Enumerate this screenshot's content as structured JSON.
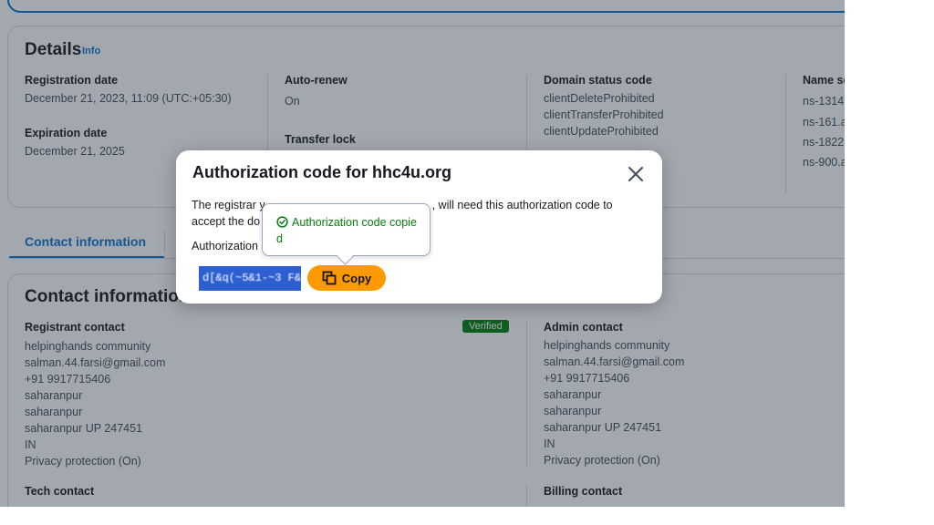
{
  "details": {
    "title": "Details",
    "info_link": "Info",
    "registration_date": {
      "label": "Registration date",
      "value": "December 21, 2023, 11:09 (UTC:+05:30)"
    },
    "expiration_date": {
      "label": "Expiration date",
      "value": "December 21, 2025"
    },
    "auto_renew": {
      "label": "Auto-renew",
      "value": "On"
    },
    "transfer_lock": {
      "label": "Transfer lock"
    },
    "domain_status": {
      "label": "Domain status code",
      "values": [
        "clientDeleteProhibited",
        "clientTransferProhibited",
        "clientUpdateProhibited"
      ]
    },
    "name_servers": {
      "label": "Name se",
      "values": [
        "ns-1314",
        "ns-161.a",
        "ns-1822",
        "ns-900.a"
      ]
    }
  },
  "tabs": {
    "contact_information": "Contact information"
  },
  "contact": {
    "title": "Contact information",
    "registrant": {
      "label": "Registrant contact",
      "badge": "Verified",
      "lines": [
        "helpinghands community",
        "salman.44.farsi@gmail.com",
        "+91 9917715406",
        "saharanpur",
        "saharanpur",
        "saharanpur UP 247451",
        "IN",
        "Privacy protection (On)"
      ]
    },
    "admin": {
      "label": "Admin contact",
      "lines": [
        "helpinghands community",
        "salman.44.farsi@gmail.com",
        "+91 9917715406",
        "saharanpur",
        "saharanpur",
        "saharanpur UP 247451",
        "IN",
        "Privacy protection (On)"
      ]
    },
    "tech": {
      "label": "Tech contact"
    },
    "billing": {
      "label": "Billing contact"
    }
  },
  "modal": {
    "title": "Authorization code for hhc4u.org",
    "description_part1": "The registrar y",
    "description_part2": ", will need this authorization code to",
    "description_line2": "accept the do",
    "code_label": "Authorization",
    "code_value": "d[&q(~5&1-~3 F&\\",
    "copy_label": "Copy",
    "popover_text": "Authorization code copied"
  },
  "colors": {
    "accent": "#0972d3",
    "primary_button": "#ff9900",
    "success": "#037f0c"
  }
}
